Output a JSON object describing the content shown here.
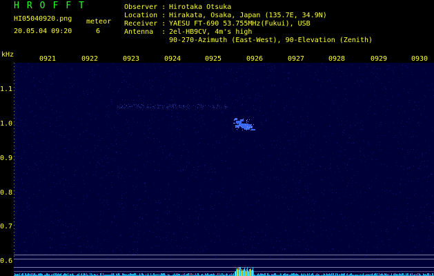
{
  "header": {
    "title": "HROFFT",
    "filename": "HI05040920.png",
    "datetime": "20.05.04 09:20",
    "meteor_label": "meteor",
    "meteor_count": "6"
  },
  "info": {
    "observer_label": "Observer :",
    "observer": "Hirotaka Otsuka",
    "location_label": "Location :",
    "location": "Hirakata, Osaka, Japan (135.7E, 34.9N)",
    "receiver_label": "Receiver :",
    "receiver": "YAESU FT-690 53.755MHz(Fukui), USB",
    "antenna_label": "Antenna  :",
    "antenna": "2el-HB9CV, 4m's high",
    "antenna_line2": "90-270-Azimuth (East-West), 90-Elevation (Zenith)"
  },
  "spectrogram": {
    "y_unit": "kHz",
    "x_ticks": [
      "0921",
      "0922",
      "0923",
      "0924",
      "0925",
      "0926",
      "0927",
      "0928",
      "0929",
      "0930"
    ],
    "y_ticks": [
      "1.1",
      "1.0",
      "0.9",
      "0.8",
      "0.7",
      "0.6"
    ],
    "colors": {
      "background": "#000038",
      "noise": "#1a1aa0",
      "echo": "#3b6bff",
      "tick": "#ffff33",
      "power": "#22c8ff"
    }
  }
}
